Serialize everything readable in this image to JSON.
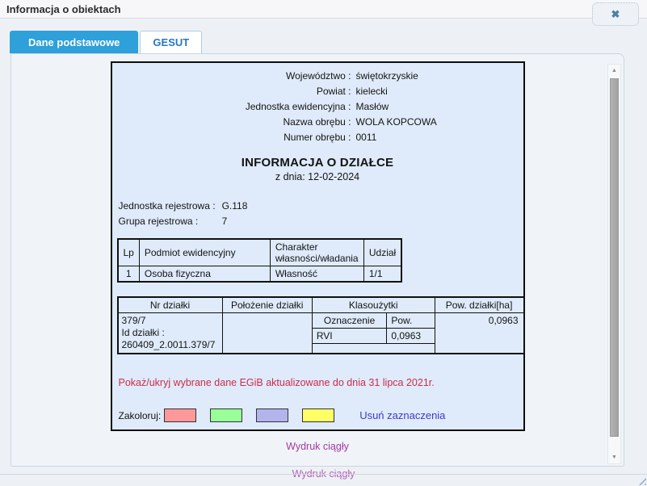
{
  "window": {
    "title": "Informacja o obiektach",
    "close_icon": "✖"
  },
  "tabs": {
    "basic": "Dane podstawowe",
    "gesut": "GESUT"
  },
  "doc": {
    "header_fields": [
      {
        "label": "Województwo :",
        "value": "świętokrzyskie"
      },
      {
        "label": "Powiat :",
        "value": "kielecki"
      },
      {
        "label": "Jednostka ewidencyjna :",
        "value": "Masłów"
      },
      {
        "label": "Nazwa obrębu :",
        "value": "WOLA KOPCOWA"
      },
      {
        "label": "Numer obrębu :",
        "value": "0011"
      }
    ],
    "title": "INFORMACJA O DZIAŁCE",
    "subtitle": "z dnia: 12-02-2024",
    "register_fields": [
      {
        "label": "Jednostka rejestrowa :",
        "value": "G.118"
      },
      {
        "label": "Grupa rejestrowa :",
        "value": "7"
      }
    ],
    "owners_table": {
      "headers": [
        "Lp",
        "Podmiot ewidencyjny",
        "Charakter własności/władania",
        "Udział"
      ],
      "rows": [
        [
          "1",
          "Osoba fizyczna",
          "Własność",
          "1/1"
        ]
      ]
    },
    "parcel_table": {
      "headers": [
        "Nr działki",
        "Położenie działki",
        "Klasoużytki",
        "Pow. działki[ha]"
      ],
      "parcel_lines": [
        "379/7",
        "Id działki :",
        "260409_2.0011.379/7"
      ],
      "location": "",
      "landuse": {
        "headers": [
          "Oznaczenie",
          "Pow."
        ],
        "rows": [
          [
            "RVI",
            "0,0963"
          ]
        ]
      },
      "area": "0,0963"
    },
    "egib_toggle_link": "Pokaż/ukryj wybrane dane EGiB aktualizowane do dnia 31 lipca 2021r.",
    "colorize_label": "Zakoloruj:",
    "swatch_colors": [
      "#ff9999",
      "#99ff99",
      "#b4b4ec",
      "#ffff66"
    ],
    "clear_selection_link": "Usuń zaznaczenia",
    "print_link": "Wydruk ciągły"
  },
  "print_link_clipped": "Wydruk ciągły",
  "colors": {
    "active_tab": "#2ea0da",
    "inactive_tab_text": "#2878be",
    "egib_link": "#ce2b4a",
    "clear_link": "#3a3acd",
    "print_link": "#a338a3",
    "close_icon": "#4c7fa8",
    "document_bg": "#dfebfa"
  }
}
